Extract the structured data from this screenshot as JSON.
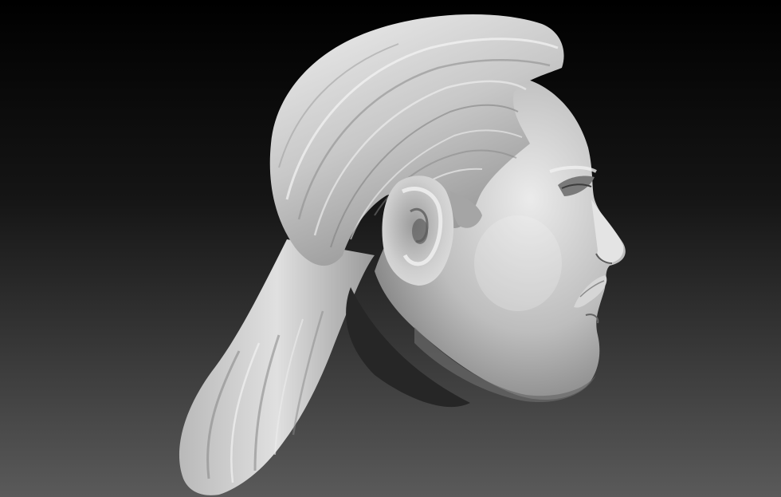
{
  "scene": {
    "subject": "sculpted-head-render",
    "colors": {
      "bg_top": "#000000",
      "bg_mid": "#151515",
      "bg_bottom": "#5a5a5a",
      "clay_light": "#e6e6e6",
      "clay_mid": "#b4b4b4",
      "clay_dark": "#6e6e6e",
      "clay_shadow": "#3a3a3a"
    }
  }
}
